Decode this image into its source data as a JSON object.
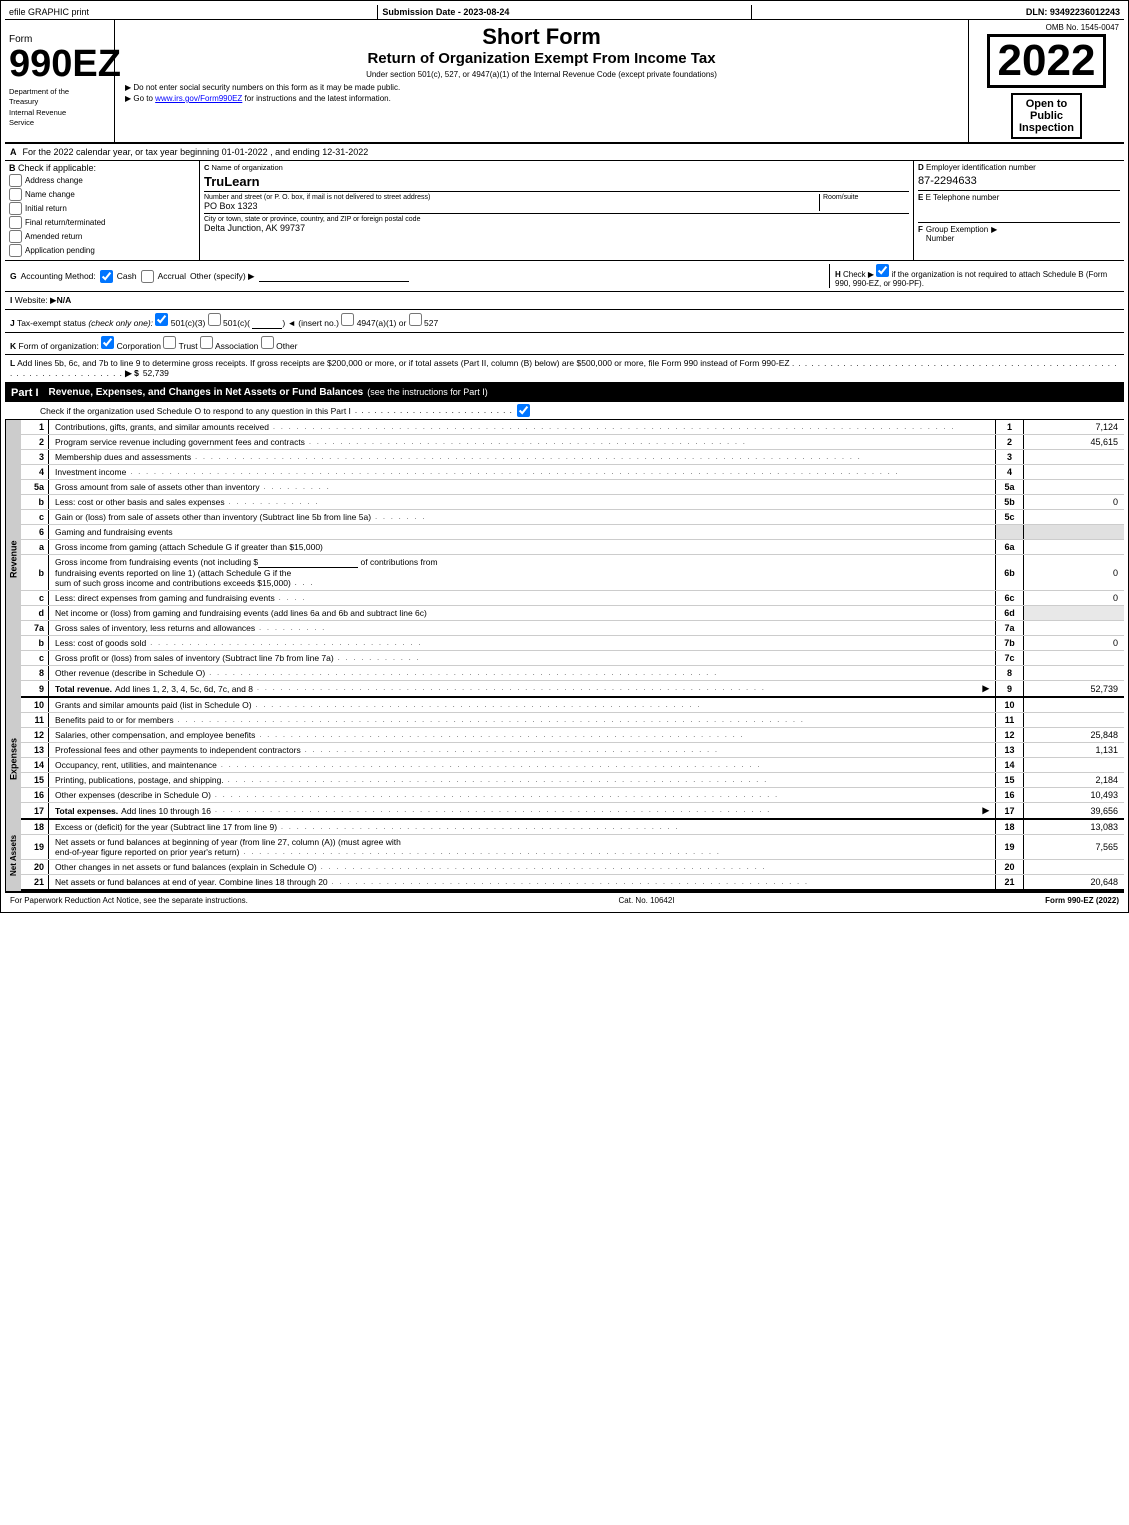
{
  "top_bar": {
    "efile": "efile GRAPHIC print",
    "submission": "Submission Date - 2023-08-24",
    "dln": "DLN: 93492236012243"
  },
  "header": {
    "form_word": "Form",
    "form_number": "990EZ",
    "form_sub": "",
    "title_short": "Short Form",
    "title_return": "Return of Organization Exempt From Income Tax",
    "under_section": "Under section 501(c), 527, or 4947(a)(1) of the Internal Revenue Code (except private foundations)",
    "do_not_enter": "▶ Do not enter social security numbers on this form as it may be made public.",
    "go_to": "▶ Go to www.irs.gov/Form990EZ for instructions and the latest information.",
    "omb_no": "OMB No. 1545-0047",
    "year": "2022",
    "open_to": "Open to",
    "public": "Public",
    "inspection": "Inspection",
    "dept_line1": "Department of the",
    "dept_line2": "Treasury",
    "dept_line3": "Internal Revenue",
    "dept_line4": "Service"
  },
  "section_a": {
    "label": "A",
    "text": "For the 2022 calendar year, or tax year beginning 01-01-2022 , and ending 12-31-2022"
  },
  "section_b": {
    "label": "B",
    "sublabel": "Check if applicable:",
    "address_change": "Address change",
    "name_change": "Name change",
    "initial_return": "Initial return",
    "final_return": "Final return/terminated",
    "amended_return": "Amended return",
    "application_pending": "Application pending"
  },
  "section_c": {
    "label": "C",
    "org_name_label": "Name of organization",
    "org_name": "TruLearn",
    "street_label": "Number and street (or P. O. box, if mail is not delivered to street address)",
    "street": "PO Box 1323",
    "room_label": "Room/suite",
    "room": "",
    "city_label": "City or town, state or province, country, and ZIP or foreign postal code",
    "city": "Delta Junction, AK  99737"
  },
  "section_d": {
    "label": "D",
    "sublabel": "Employer identification number",
    "ein": "87-2294633",
    "phone_label": "E Telephone number",
    "phone": "",
    "group_label": "F Group Exemption",
    "group_sub": "Number",
    "group_arrow": "▶"
  },
  "section_g": {
    "label": "G",
    "accounting_label": "Accounting Method:",
    "cash_checked": true,
    "cash_label": "Cash",
    "accrual_checked": false,
    "accrual_label": "Accrual",
    "other_label": "Other (specify) ▶",
    "other_line": "________________________",
    "h_label": "H",
    "h_check_label": "Check ▶",
    "h_checked": true,
    "h_text": "if the organization is not required to attach Schedule B (Form 990, 990-EZ, or 990-PF)."
  },
  "section_i": {
    "label": "I",
    "website_label": "Website:",
    "arrow": "▶",
    "website": "N/A"
  },
  "section_j": {
    "label": "J",
    "text": "Tax-exempt status",
    "check_only": "(check only one):",
    "c3_checked": true,
    "c3_label": "501(c)(3)",
    "cc_checked": false,
    "cc_label": "501(c)(",
    "cc_insert": ") ◄ (insert no.)",
    "c4947_checked": false,
    "c4947_label": "4947(a)(1) or",
    "c527_checked": false,
    "c527_label": "527"
  },
  "section_k": {
    "label": "K",
    "text": "Form of organization:",
    "corp_checked": true,
    "corp_label": "Corporation",
    "trust_checked": false,
    "trust_label": "Trust",
    "assoc_checked": false,
    "assoc_label": "Association",
    "other_checked": false,
    "other_label": "Other"
  },
  "section_l": {
    "label": "L",
    "text": "Add lines 5b, 6c, and 7b to line 9 to determine gross receipts. If gross receipts are $200,000 or more, or if total assets (Part II, column (B) below) are $500,000 or more, file Form 990 instead of Form 990-EZ",
    "dots": ". . . . . . . . . . . . . . . . . . . . . . . . . . . . . . . . . . . . . . . . . . . . . . . . . . . . . . . . . . . . . . . .",
    "arrow": "▶ $",
    "amount": "52,739"
  },
  "part1": {
    "label": "Part I",
    "title": "Revenue, Expenses, and Changes in Net Assets or Fund Balances",
    "see_instructions": "(see the instructions for Part I)",
    "check_label": "Check if the organization used Schedule O to respond to any question in this Part I",
    "dots_check": ". . . . . . . . . . . . . . . . . . . . . . . . .",
    "rows": [
      {
        "num": "1",
        "desc": "Contributions, gifts, grants, and similar amounts received",
        "dots": ". . . . . . . . . . . . . . . . . . . . . . . . . . . . . . . . . . . . . . . . . . . . . . . . . . . . . . . . .",
        "line": "1",
        "amount": "7,124"
      },
      {
        "num": "2",
        "desc": "Program service revenue including government fees and contracts",
        "dots": ". . . . . . . . . . . . . . . . . . . . . . . . . . . . . . . . . . . . . . . . . . . . . . . . . . .",
        "line": "2",
        "amount": "45,615"
      },
      {
        "num": "3",
        "desc": "Membership dues and assessments",
        "dots": ". . . . . . . . . . . . . . . . . . . . . . . . . . . . . . . . . . . . . . . . . . . . . . . . . . . . . . . . . . . . . . . . . . . . . . . . .",
        "line": "3",
        "amount": ""
      },
      {
        "num": "4",
        "desc": "Investment income",
        "dots": ". . . . . . . . . . . . . . . . . . . . . . . . . . . . . . . . . . . . . . . . . . . . . . . . . . . . . . . . . . . . . . . . . . . . . . . . . . . . . . . . . . . . . . . . . . . .",
        "line": "4",
        "amount": ""
      },
      {
        "num": "5a",
        "desc": "Gross amount from sale of assets other than inventory",
        "dots": ". . . . . . . . .",
        "ref": "5a",
        "ref_val": ""
      },
      {
        "num": "5b",
        "desc": "Less: cost or other basis and sales expenses",
        "dots": ". . . . . . . . . . . .",
        "ref": "5b",
        "ref_val": "0"
      },
      {
        "num": "5c",
        "desc": "Gain or (loss) from sale of assets other than inventory (Subtract line 5b from line 5a)",
        "dots": ". . . . . . .",
        "line": "5c",
        "amount": ""
      },
      {
        "num": "6",
        "desc": "Gaming and fundraising events",
        "dots": ""
      },
      {
        "num": "6a",
        "desc": "Gross income from gaming (attach Schedule G if greater than $15,000)",
        "ref": "6a",
        "ref_val": ""
      },
      {
        "num": "6b",
        "desc": "Gross income from fundraising events (not including $",
        "blank": "_______________",
        "of": " of contributions from",
        "line2": "fundraising events reported on line 1) (attach Schedule G if the",
        "line3": "sum of such gross income and contributions exceeds $15,000)",
        "dots2": ". . .",
        "ref": "6b",
        "ref_val": "0"
      },
      {
        "num": "6c",
        "desc": "Less: direct expenses from gaming and fundraising events",
        "dots": ". . . .",
        "ref": "6c",
        "ref_val": "0"
      },
      {
        "num": "6d",
        "desc": "Net income or (loss) from gaming and fundraising events (add lines 6a and 6b and subtract line 6c)",
        "line": "6d",
        "amount": ""
      },
      {
        "num": "7a",
        "desc": "Gross sales of inventory, less returns and allowances",
        "dots": ". . . . . . . . .",
        "ref": "7a",
        "ref_val": ""
      },
      {
        "num": "7b",
        "desc": "Less: cost of goods sold",
        "dots": ". . . . . . . . . . . . . . . . . . . . . . . . . . . . . . .",
        "ref": "7b",
        "ref_val": "0"
      },
      {
        "num": "7c",
        "desc": "Gross profit or (loss) from sales of inventory (Subtract line 7b from line 7a)",
        "dots": ". . . . . . . . . . .",
        "line": "7c",
        "amount": ""
      },
      {
        "num": "8",
        "desc": "Other revenue (describe in Schedule O)",
        "dots": ". . . . . . . . . . . . . . . . . . . . . . . . . . . . . . . . . . . . . . . . . . . . . . . . . . . . . . . . . . . . . . . . .",
        "line": "8",
        "amount": ""
      },
      {
        "num": "9",
        "desc": "Total revenue. Add lines 1, 2, 3, 4, 5c, 6d, 7c, and 8",
        "dots": ". . . . . . . . . . . . . . . . . . . . . . . . . . . . . . . . . . . . . . . . . . . . . . . . . . . . . . . . . . . . . . . . .",
        "arrow": "▶",
        "line": "9",
        "amount": "52,739"
      }
    ]
  },
  "expenses_rows": [
    {
      "num": "10",
      "desc": "Grants and similar amounts paid (list in Schedule O)",
      "dots": ". . . . . . . . . . . . . . . . . . . . . . . . . . . . . . . . . . . . . . . . . . . . . . . . . . . . . . . . . .",
      "line": "10",
      "amount": ""
    },
    {
      "num": "11",
      "desc": "Benefits paid to or for members",
      "dots": ". . . . . . . . . . . . . . . . . . . . . . . . . . . . . . . . . . . . . . . . . . . . . . . . . . . . . . . . . . . . . . . . . . . . . . . . . . . . . . . .",
      "line": "11",
      "amount": ""
    },
    {
      "num": "12",
      "desc": "Salaries, other compensation, and employee benefits",
      "dots": ". . . . . . . . . . . . . . . . . . . . . . . . . . . . . . . . . . . . . . . . . . . . . . . . . . . . . . . . . . . . . . .",
      "line": "12",
      "amount": "25,848"
    },
    {
      "num": "13",
      "desc": "Professional fees and other payments to independent contractors",
      "dots": ". . . . . . . . . . . . . . . . . . . . . . . . . . . . . . . . . . . . . . . . . . . . . . . . . . . . . .",
      "line": "13",
      "amount": "1,131"
    },
    {
      "num": "14",
      "desc": "Occupancy, rent, utilities, and maintenance",
      "dots": ". . . . . . . . . . . . . . . . . . . . . . . . . . . . . . . . . . . . . . . . . . . . . . . . . . . . . . . . . . . . . . . . . . . . . .",
      "line": "14",
      "amount": ""
    },
    {
      "num": "15",
      "desc": "Printing, publications, postage, and shipping.",
      "dots": ". . . . . . . . . . . . . . . . . . . . . . . . . . . . . . . . . . . . . . . . . . . . . . . . . . . . . . . . . . . . . . . . . . . . . .",
      "line": "15",
      "amount": "2,184"
    },
    {
      "num": "16",
      "desc": "Other expenses (describe in Schedule O)",
      "dots": ". . . . . . . . . . . . . . . . . . . . . . . . . . . . . . . . . . . . . . . . . . . . . . . . . . . . . . . . . . . . . . . . . . . . . . . .",
      "line": "16",
      "amount": "10,493"
    },
    {
      "num": "17",
      "desc": "Total expenses. Add lines 10 through 16",
      "dots": ". . . . . . . . . . . . . . . . . . . . . . . . . . . . . . . . . . . . . . . . . . . . . . . . . . . . . . . . . . . . . . . . . . . . . . .",
      "arrow": "▶",
      "line": "17",
      "amount": "39,656"
    }
  ],
  "net_assets_rows": [
    {
      "num": "18",
      "desc": "Excess or (deficit) for the year (Subtract line 17 from line 9)",
      "dots": ". . . . . . . . . . . . . . . . . . . . . . . . . . . . . . . . . . . . . . . . . . . . . . . . . . . .",
      "line": "18",
      "amount": "13,083"
    },
    {
      "num": "19",
      "desc": "Net assets or fund balances at beginning of year (from line 27, column (A)) (must agree with",
      "line2": "end-of-year figure reported on prior year's return)",
      "dots": ". . . . . . . . . . . . . . . . . . . . . . . . . . . . . . . . . . . . . . . . . . . . . . . . . . . . . . . . . . . . .",
      "line": "19",
      "amount": "7,565"
    },
    {
      "num": "20",
      "desc": "Other changes in net assets or fund balances (explain in Schedule O)",
      "dots": ". . . . . . . . . . . . . . . . . . . . . . . . . . . . . . . . . . . . . . . . . . . . . . . . . . . . . . . . . .",
      "line": "20",
      "amount": ""
    },
    {
      "num": "21",
      "desc": "Net assets or fund balances at end of year. Combine lines 18 through 20",
      "dots": ". . . . . . . . . . . . . . . . . . . . . . . . . . . . . . . . . . . . . . . . . . . . . . . . . . . . . . . . . . . . .",
      "line": "21",
      "amount": "20,648"
    }
  ],
  "footer": {
    "paperwork_text": "For Paperwork Reduction Act Notice, see the separate instructions.",
    "cat_no": "Cat. No. 10642I",
    "form_ref": "Form 990-EZ (2022)"
  }
}
